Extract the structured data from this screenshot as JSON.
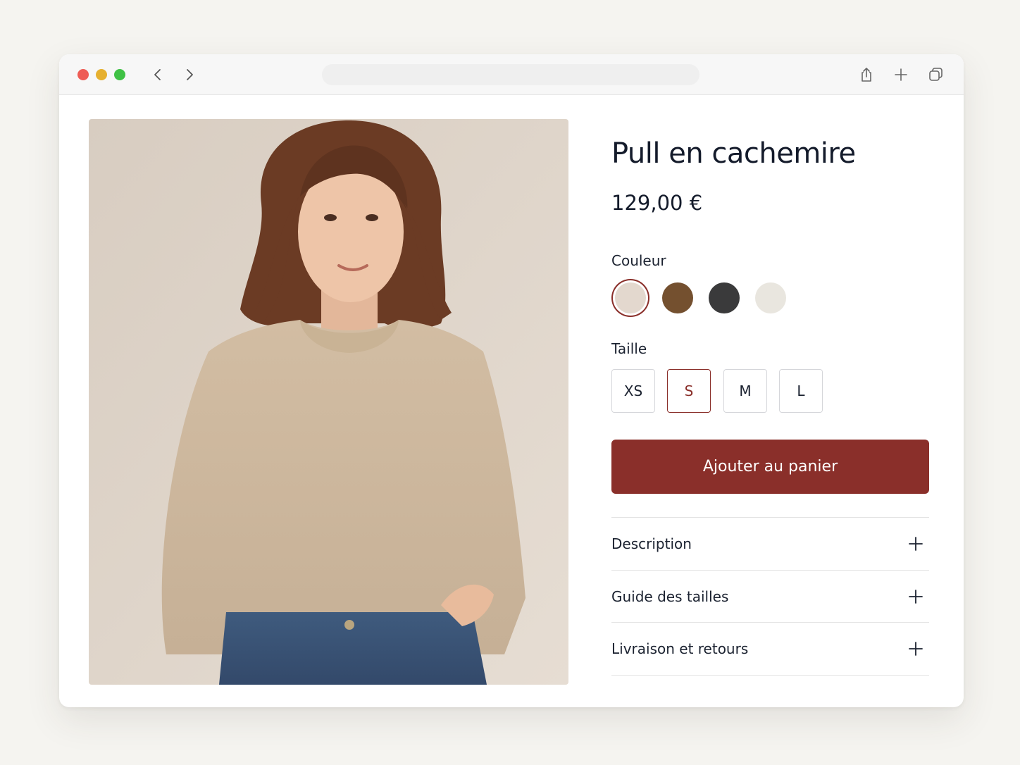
{
  "browser": {
    "address_value": "",
    "icons": [
      "chevron-left-icon",
      "chevron-right-icon",
      "share-icon",
      "plus-icon",
      "tabs-icon"
    ]
  },
  "product": {
    "title": "Pull en cachemire",
    "price": "129,00 €",
    "color_label": "Couleur",
    "colors": [
      {
        "name": "beige",
        "hex": "#e3d8ce",
        "selected": true
      },
      {
        "name": "brown",
        "hex": "#74502f",
        "selected": false
      },
      {
        "name": "charcoal",
        "hex": "#3a3a3b",
        "selected": false
      },
      {
        "name": "cream",
        "hex": "#e9e6df",
        "selected": false
      }
    ],
    "size_label": "Taille",
    "sizes": [
      {
        "label": "XS",
        "selected": false
      },
      {
        "label": "S",
        "selected": true
      },
      {
        "label": "M",
        "selected": false
      },
      {
        "label": "L",
        "selected": false
      }
    ],
    "add_to_cart": "Ajouter au panier",
    "accordion": [
      {
        "label": "Description"
      },
      {
        "label": "Guide des tailles"
      },
      {
        "label": "Livraison et retours"
      }
    ]
  },
  "theme": {
    "accent": "#8a2f2a",
    "text": "#141b2b",
    "background": "#f5f4f0"
  }
}
